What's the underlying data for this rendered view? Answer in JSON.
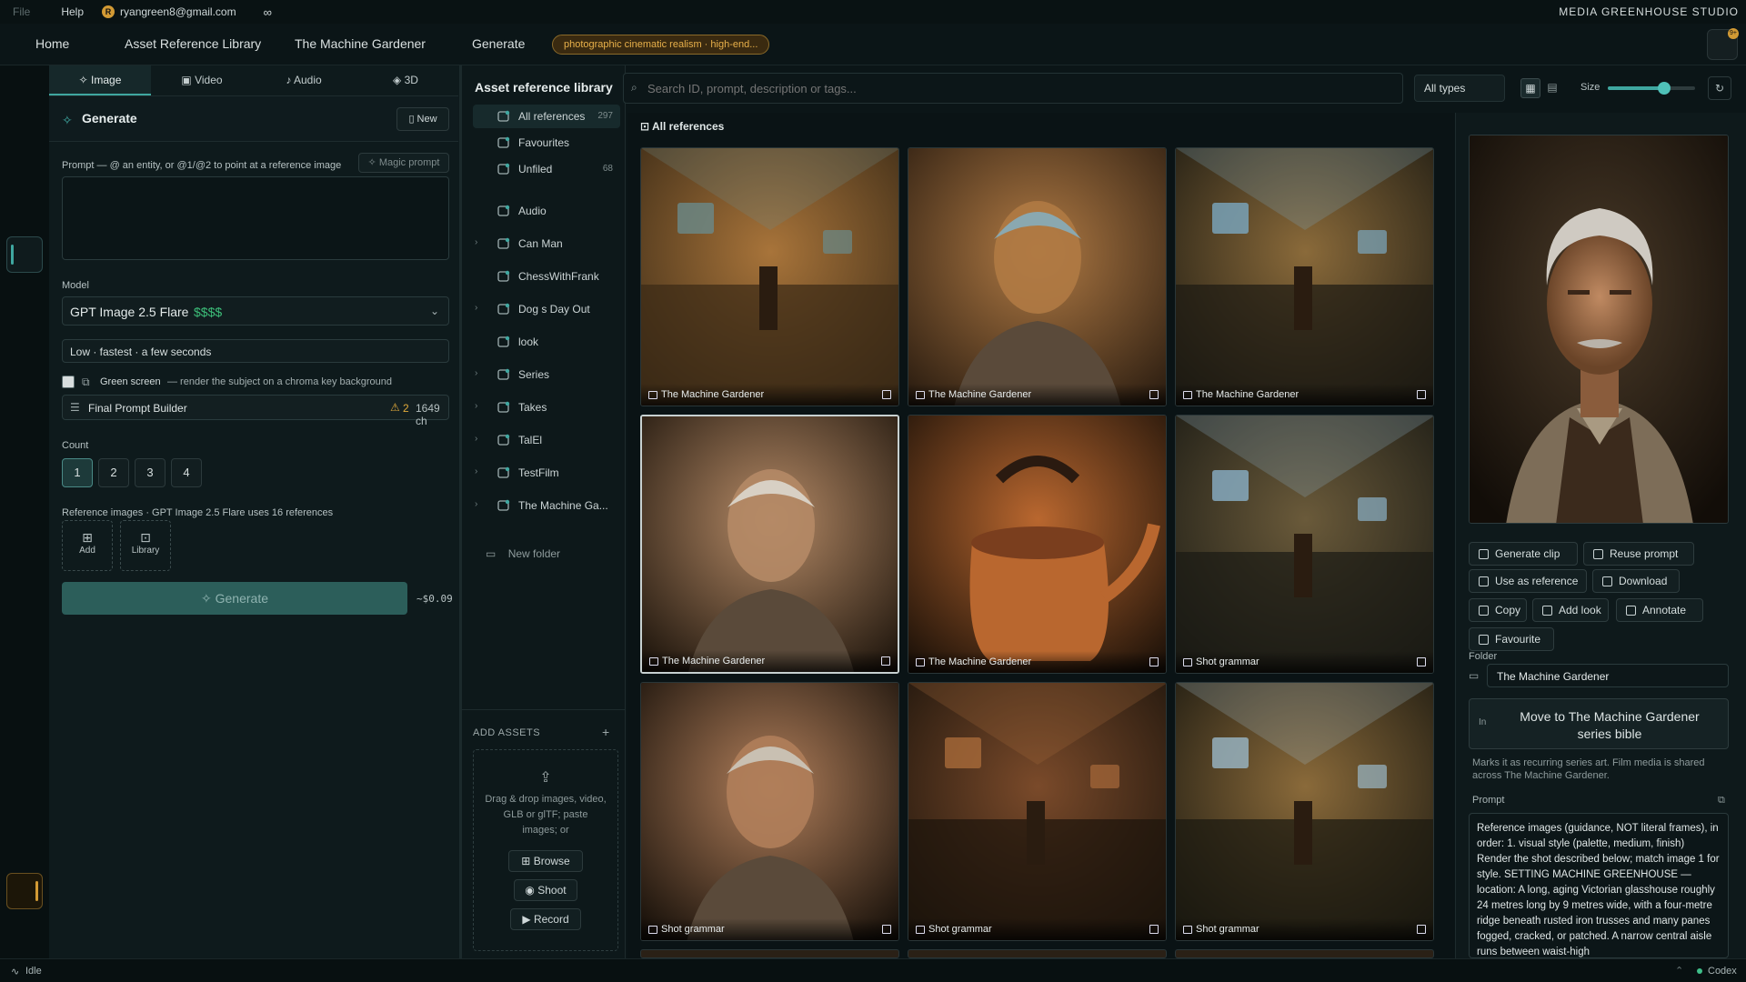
{
  "menubar": {
    "file": "File",
    "help": "Help",
    "user_initial": "R",
    "user_email": "ryangreen8@gmail.com",
    "link_icon": "∞",
    "studio_name": "MEDIA GREENHOUSE STUDIO"
  },
  "topnav": {
    "home": "Home",
    "asset_library": "Asset Reference Library",
    "project": "The Machine Gardener",
    "generate": "Generate",
    "style_pill": "photographic cinematic realism · high-end...",
    "avatar_badge": "9+"
  },
  "generate_panel": {
    "tabs": [
      "Image",
      "Video",
      "Audio",
      "3D"
    ],
    "title": "Generate",
    "new_label": "New",
    "prompt_label": "Prompt — @ an entity, or @1/@2 to point at a reference image",
    "magic_prompt": "Magic prompt",
    "prompt_value": "",
    "model_label": "Model",
    "model_name": "GPT Image 2.5 Flare",
    "model_cost": "$$$$",
    "quality": "Low · fastest · a few seconds",
    "green_screen_label": "Green screen",
    "green_screen_desc": "— render the subject on a chroma key background",
    "final_prompt_builder": "Final Prompt Builder",
    "warn_count": "2",
    "char_count": "1649 ch",
    "count_label": "Count",
    "counts": [
      "1",
      "2",
      "3",
      "4"
    ],
    "ref_label": "Reference images · GPT Image 2.5 Flare uses 16 references",
    "add_label": "Add",
    "library_label": "Library",
    "generate_btn": "Generate",
    "cost": "~$0.09"
  },
  "library": {
    "heading": "Asset reference library",
    "search_placeholder": "Search ID, prompt, description or tags...",
    "types": "All types",
    "size_label": "Size",
    "size_value": 0.65,
    "nav": [
      {
        "label": "All references",
        "count": "297",
        "chev": false
      },
      {
        "label": "Favourites",
        "count": "",
        "chev": false
      },
      {
        "label": "Unfiled",
        "count": "68",
        "chev": false
      },
      {
        "label": "Audio",
        "count": "",
        "chev": false
      },
      {
        "label": "Can Man",
        "count": "",
        "chev": true
      },
      {
        "label": "ChessWithFrank",
        "count": "",
        "chev": false
      },
      {
        "label": "Dog s Day Out",
        "count": "",
        "chev": true
      },
      {
        "label": "look",
        "count": "",
        "chev": false
      },
      {
        "label": "Series",
        "count": "",
        "chev": true
      },
      {
        "label": "Takes",
        "count": "",
        "chev": true
      },
      {
        "label": "TalEl",
        "count": "",
        "chev": true
      },
      {
        "label": "TestFilm",
        "count": "",
        "chev": true
      },
      {
        "label": "The Machine Ga...",
        "count": "",
        "chev": true
      }
    ],
    "new_folder": "New folder",
    "add_assets": "ADD ASSETS",
    "drop_text": [
      "Drag & drop images, video,",
      "GLB or glTF; paste",
      "images; or"
    ],
    "browse": "Browse",
    "shoot": "Shoot",
    "record": "Record",
    "grid_title": "All references",
    "tiles": [
      "The Machine Gardener",
      "The Machine Gardener",
      "The Machine Gardener",
      "The Machine Gardener",
      "The Machine Gardener",
      "Shot grammar",
      "Shot grammar",
      "Shot grammar",
      "Shot grammar"
    ]
  },
  "detail": {
    "actions": [
      "Generate clip",
      "Reuse prompt",
      "Use as reference",
      "Download",
      "Copy",
      "Add look",
      "Annotate",
      "Favourite"
    ],
    "folder_label": "Folder",
    "folder_value": "The Machine Gardener",
    "move_btn": "Move to The Machine Gardener series bible",
    "move_icon": "In",
    "move_note": "Marks it as recurring series art. Film media is shared across The Machine Gardener.",
    "prompt_label": "Prompt",
    "prompt_text": "Reference images (guidance, NOT literal frames), in order: 1. visual style (palette, medium, finish) Render the shot described below; match image 1 for style. SETTING MACHINE GREENHOUSE — location: A long, aging Victorian glasshouse roughly 24 metres long by 9 metres wide, with a four-metre ridge beneath rusted iron trusses and many panes fogged, cracked, or patched. A narrow central aisle runs between waist-high"
  },
  "status": {
    "state": "Idle",
    "agent": "Codex"
  },
  "colors": {
    "accent": "#3fa7a0",
    "amber": "#d29a34",
    "bg": "#0b1517"
  }
}
